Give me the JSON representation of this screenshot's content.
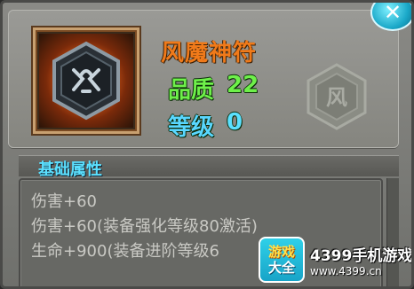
{
  "item": {
    "name": "风魔神符",
    "quality_label": "品质",
    "quality_value": "22",
    "level_label": "等级",
    "level_value": "0",
    "element_char": "风",
    "icon": "rune-hexagon-icon"
  },
  "close_button": {
    "icon": "close-icon",
    "glyph": "✕"
  },
  "attributes": {
    "title": "基础属性",
    "lines": [
      "伤害+60",
      "伤害+60(装备强化等级80激活)",
      "生命+900(装备进阶等级6"
    ]
  },
  "watermark": {
    "logo_top": "游戏",
    "logo_bottom": "大全",
    "brand": "4399手机游戏",
    "url": "www.4399.cn"
  },
  "colors": {
    "item_name": "#f07a1a",
    "quality": "#6ef04a",
    "level": "#59d7ff",
    "section_title": "#5be0ff",
    "attr_text": "#c9c9c4"
  }
}
